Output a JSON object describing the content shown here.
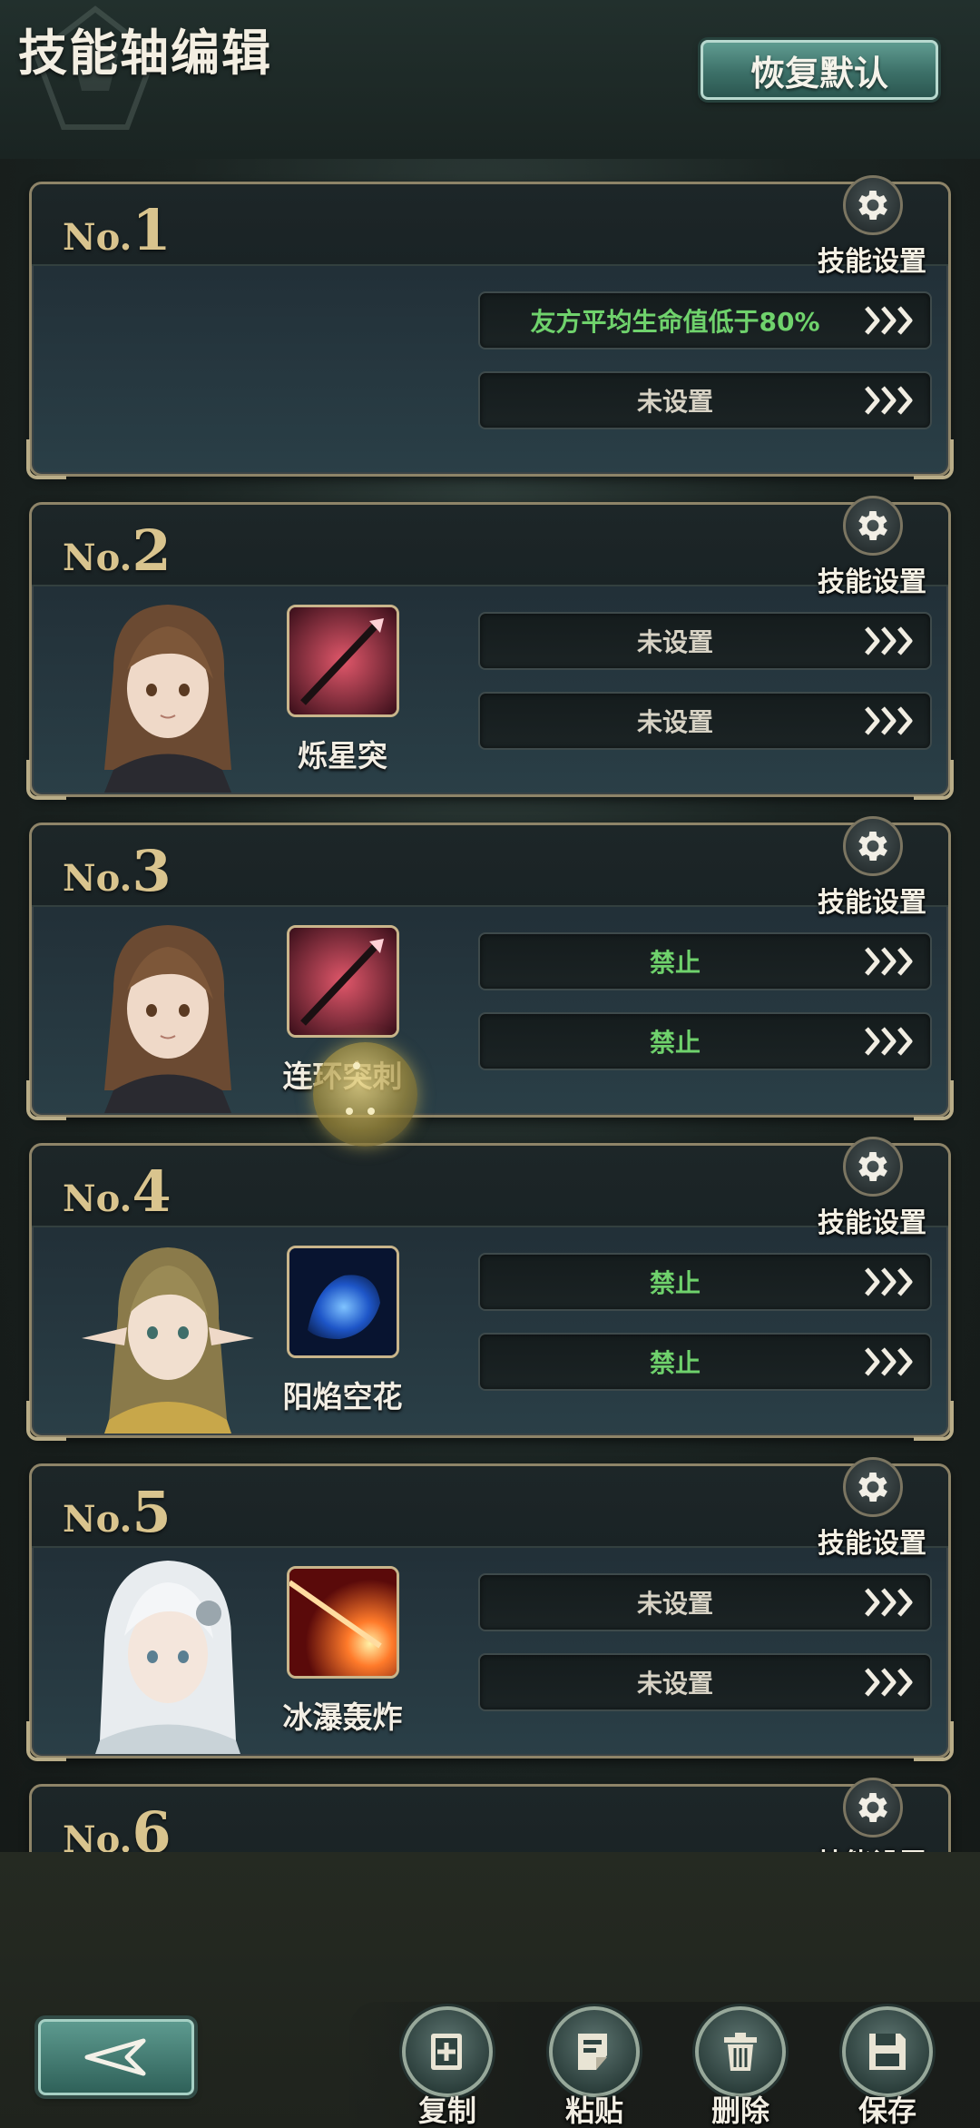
{
  "header": {
    "title": "技能轴编辑",
    "reset_label": "恢复默认"
  },
  "settings_label": "技能设置",
  "no_prefix": "No.",
  "cards": [
    {
      "num": "1",
      "skill_name": "",
      "conditions": [
        {
          "text": "友方平均生命值低于80%",
          "green": true
        },
        {
          "text": "未设置",
          "green": false
        }
      ]
    },
    {
      "num": "2",
      "skill_name": "烁星突",
      "conditions": [
        {
          "text": "未设置",
          "green": false
        },
        {
          "text": "未设置",
          "green": false
        }
      ]
    },
    {
      "num": "3",
      "skill_name": "连环突刺",
      "conditions": [
        {
          "text": "禁止",
          "green": true
        },
        {
          "text": "禁止",
          "green": true
        }
      ]
    },
    {
      "num": "4",
      "skill_name": "阳焰空花",
      "conditions": [
        {
          "text": "禁止",
          "green": true
        },
        {
          "text": "禁止",
          "green": true
        }
      ]
    },
    {
      "num": "5",
      "skill_name": "冰瀑轰炸",
      "conditions": [
        {
          "text": "未设置",
          "green": false
        },
        {
          "text": "未设置",
          "green": false
        }
      ]
    },
    {
      "num": "6"
    }
  ],
  "toolbar": {
    "copy_label": "复制",
    "paste_label": "粘贴",
    "delete_label": "删除",
    "save_label": "保存"
  },
  "icons": {
    "settings": "gear-icon",
    "arrows": "triple-chevron-right-icon",
    "back": "back-arrow-icon",
    "copy": "copy-plus-icon",
    "paste": "paste-icon",
    "delete": "trash-icon",
    "save": "floppy-disk-icon"
  },
  "colors": {
    "accent_green": "#6fd26c",
    "gold": "#d9c48e",
    "teal_button": "#3c7068"
  }
}
